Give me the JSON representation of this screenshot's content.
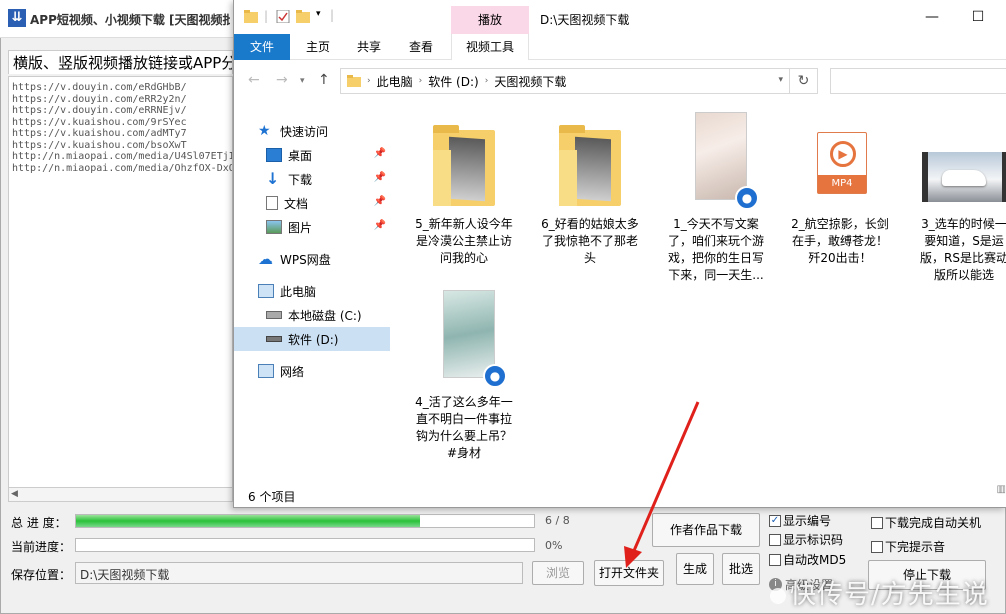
{
  "app": {
    "title": "APP短视频、小视频下载 [天图视频批",
    "heading": "横版、竖版视频播放链接或APP分",
    "links": [
      "https://v.douyin.com/eRdGHbB/",
      "https://v.douyin.com/eRR2y2n/",
      "https://v.douyin.com/eRRNEjv/",
      "https://v.kuaishou.com/9rSYec",
      "https://v.kuaishou.com/adMTy7",
      "https://v.kuaishou.com/bsoXwT",
      "http://n.miaopai.com/media/U4Sl07ETjI",
      "http://n.miaopai.com/media/OhzfOX-DxO"
    ],
    "total_progress_label": "总 进 度：",
    "total_progress_value": "6 / 8",
    "total_progress_fraction": 0.75,
    "current_progress_label": "当前进度：",
    "current_progress_value": "0%",
    "current_progress_fraction": 0,
    "save_label": "保存位置：",
    "save_path": "D:\\天图视频下载",
    "browse_label": "浏览",
    "open_folder_label": "打开文件夹",
    "author_download_label": "作者作品下载",
    "generate_label": "生成",
    "pick_label": "批选",
    "stop_label": "停止下载",
    "options": [
      {
        "label": "显示编号",
        "checked": true
      },
      {
        "label": "显示标识码",
        "checked": false
      },
      {
        "label": "自动改MD5",
        "checked": false
      }
    ],
    "options_right": [
      {
        "label": "下载完成自动关机",
        "checked": false
      },
      {
        "label": "下完提示音",
        "checked": false
      }
    ],
    "advanced_label": "高级设置"
  },
  "explorer": {
    "context_tab": "播放",
    "window_title": "D:\\天图视频下载",
    "ribbon_tabs": [
      "文件",
      "主页",
      "共享",
      "查看",
      "视频工具"
    ],
    "address": [
      "此电脑",
      "软件 (D:)",
      "天图视频下载"
    ],
    "nav": [
      {
        "label": "快速访问",
        "icon": "star-icon"
      },
      {
        "label": "桌面",
        "icon": "desktop-icon",
        "pinned": true
      },
      {
        "label": "下载",
        "icon": "download-icon",
        "pinned": true
      },
      {
        "label": "文档",
        "icon": "document-icon",
        "pinned": true
      },
      {
        "label": "图片",
        "icon": "picture-icon",
        "pinned": true
      },
      {
        "label": "WPS网盘",
        "icon": "cloud-icon"
      },
      {
        "label": "此电脑",
        "icon": "computer-icon"
      },
      {
        "label": "本地磁盘 (C:)",
        "icon": "drive-icon"
      },
      {
        "label": "软件 (D:)",
        "icon": "drive-icon",
        "selected": true
      },
      {
        "label": "网络",
        "icon": "network-icon"
      }
    ],
    "files": [
      {
        "name": "5_新年新人设今年是冷漠公主禁止访问我的心",
        "kind": "folder"
      },
      {
        "name": "6_好看的姑娘太多了我惊艳不了那老头",
        "kind": "folder"
      },
      {
        "name": "1_今天不写文案了，咱们来玩个游戏，把你的生日写下来，同一天生...",
        "kind": "video"
      },
      {
        "name": "2_航空掠影，长剑在手，敢缚苍龙！歼20出击！",
        "kind": "mp4",
        "icon_text": "MP4"
      },
      {
        "name": "3_选车的时候一要知道，S是运版，RS是比赛动版所以能选",
        "kind": "car"
      },
      {
        "name": "4_活了这么多年一直不明白一件事拉钩为什么要上吊？#身材",
        "kind": "video"
      }
    ],
    "status": "6 个项目"
  },
  "watermark": "快传号/方先生说"
}
